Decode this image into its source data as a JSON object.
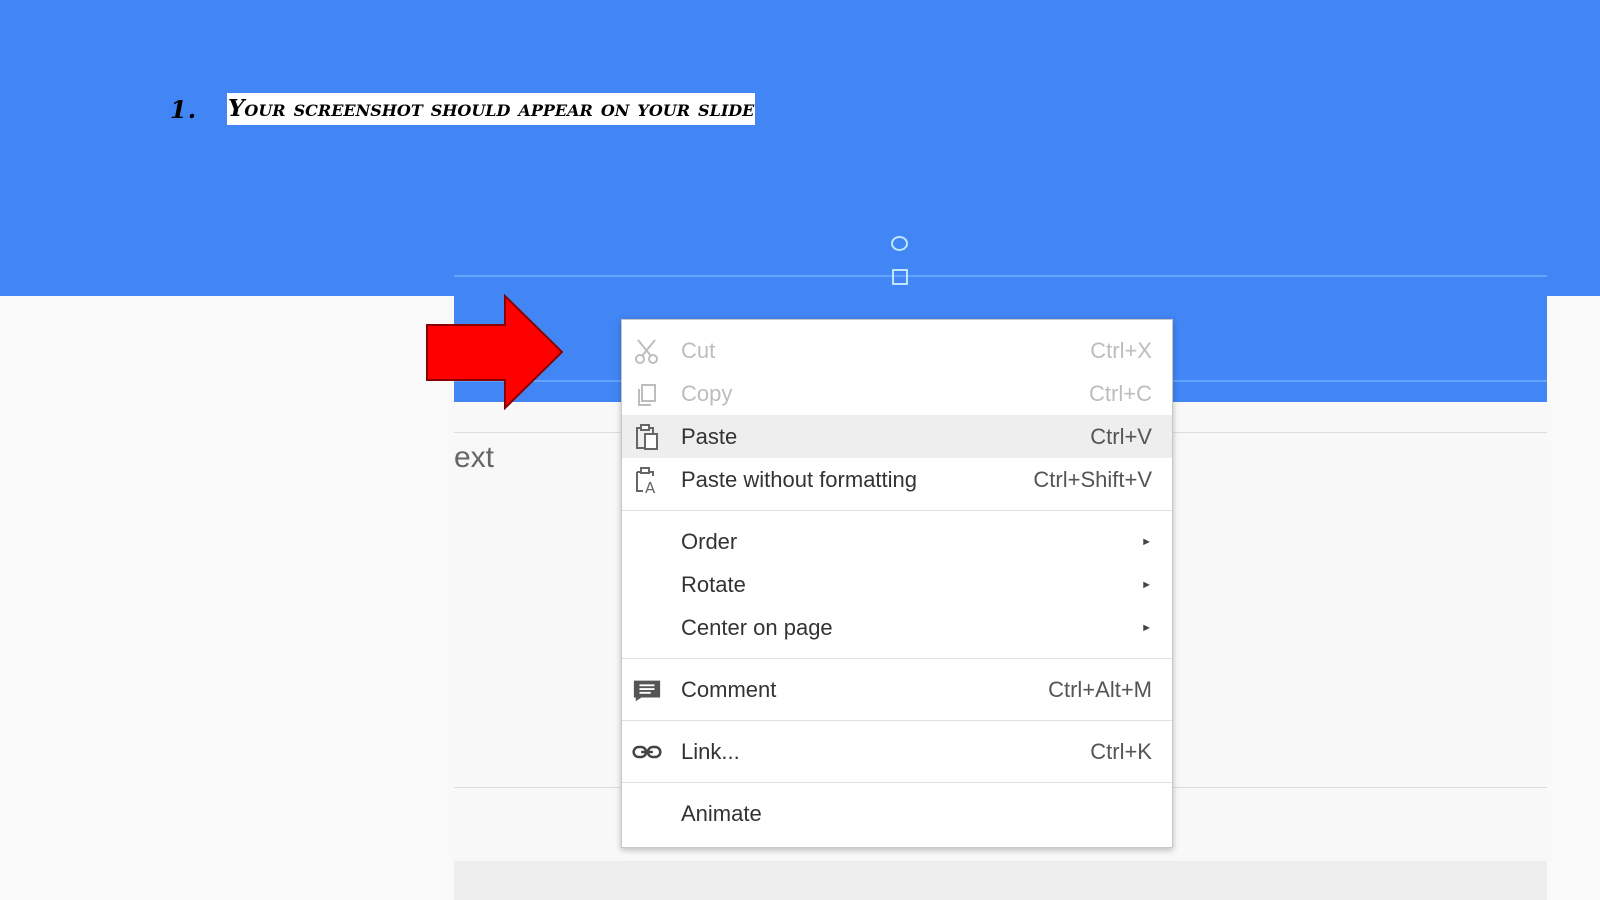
{
  "instruction": {
    "number": "1.",
    "text": "Your screenshot should appear on your slide"
  },
  "slide": {
    "placeholder_text": "ext"
  },
  "context_menu": {
    "cut": {
      "label": "Cut",
      "shortcut": "Ctrl+X",
      "icon": "scissors-icon",
      "disabled": true
    },
    "copy": {
      "label": "Copy",
      "shortcut": "Ctrl+C",
      "icon": "copy-icon",
      "disabled": true
    },
    "paste": {
      "label": "Paste",
      "shortcut": "Ctrl+V",
      "icon": "paste-icon",
      "highlighted": true
    },
    "paste_plain": {
      "label": "Paste without formatting",
      "shortcut": "Ctrl+Shift+V",
      "icon": "paste-plain-text-icon"
    },
    "order": {
      "label": "Order",
      "submenu_indicator": "►"
    },
    "rotate": {
      "label": "Rotate",
      "submenu_indicator": "►"
    },
    "center": {
      "label": "Center on page",
      "submenu_indicator": "►"
    },
    "comment": {
      "label": "Comment",
      "shortcut": "Ctrl+Alt+M",
      "icon": "comment-icon"
    },
    "link": {
      "label": "Link...",
      "shortcut": "Ctrl+K",
      "icon": "link-icon"
    },
    "animate": {
      "label": "Animate"
    }
  },
  "colors": {
    "slide_blue": "#4285f4",
    "arrow_red": "#ff0000",
    "menu_highlight": "#eeeeee"
  }
}
